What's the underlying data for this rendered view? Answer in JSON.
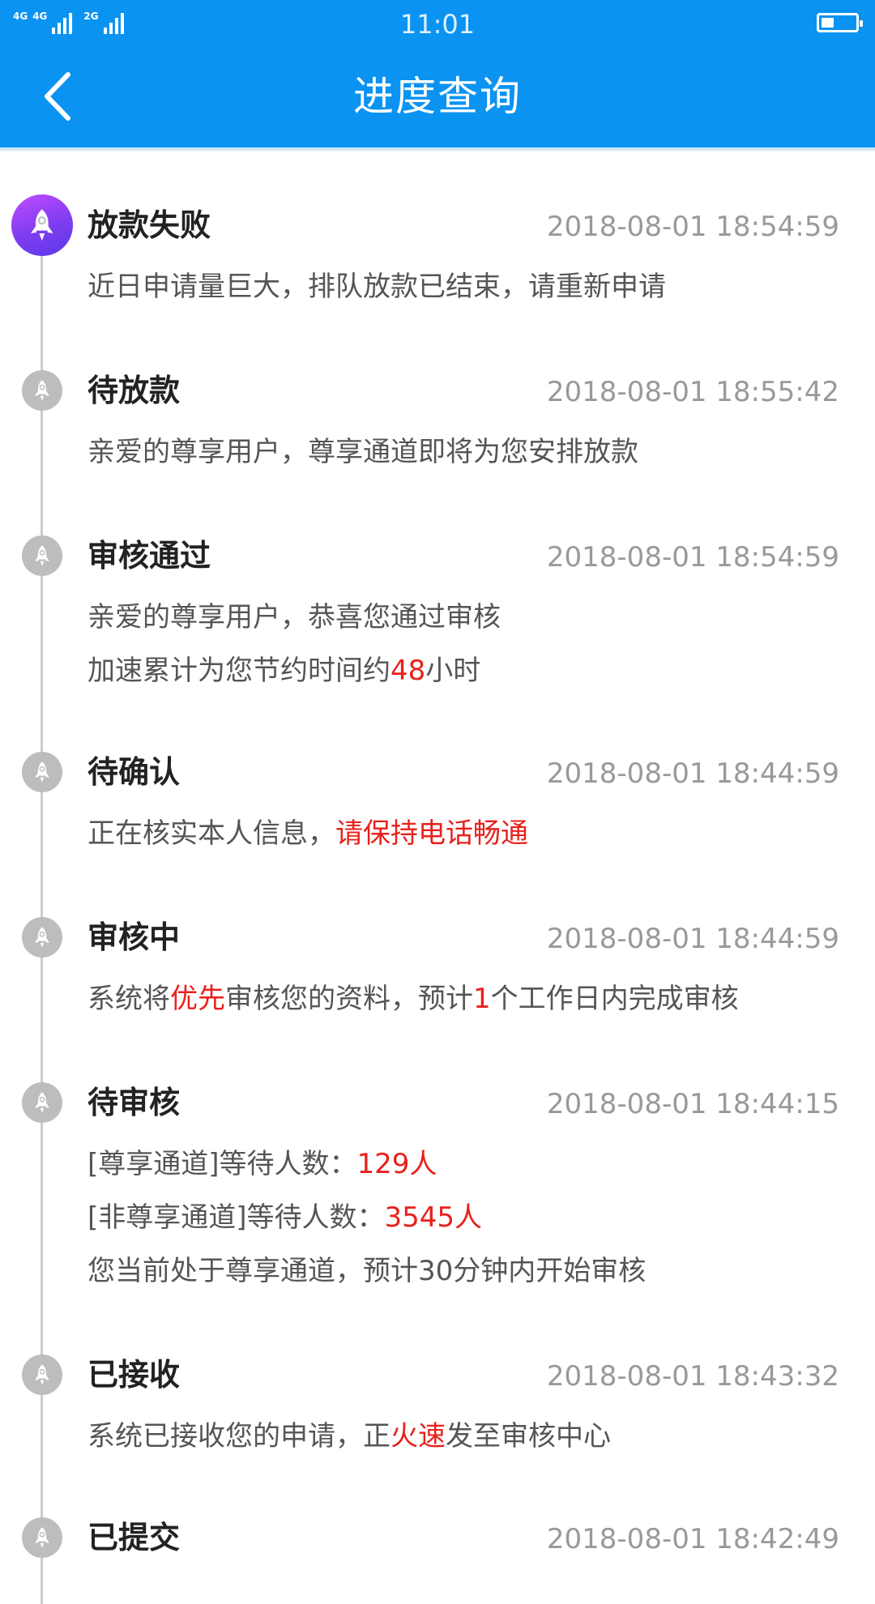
{
  "status_bar": {
    "signal1_label": "4G",
    "signal2_label": "4G",
    "signal3_label": "2G",
    "time": "11:01",
    "battery_level": 0.45
  },
  "header": {
    "title": "进度查询",
    "back_icon": "chevron-left-icon",
    "color": "#0b93f2"
  },
  "timeline": {
    "active_dot_color": "#8a3df2",
    "inactive_dot_color": "#bdbdbd",
    "highlight_color": "#e8211c",
    "entries": [
      {
        "title": "放款失败",
        "time": "2018-08-01 18:54:59",
        "lines": [
          [
            "近日申请量巨大，排队放款已结束，请重新申请"
          ]
        ]
      },
      {
        "title": "待放款",
        "time": "2018-08-01 18:55:42",
        "lines": [
          [
            "亲爱的尊享用户，尊享通道即将为您安排放款"
          ]
        ]
      },
      {
        "title": "审核通过",
        "time": "2018-08-01 18:54:59",
        "lines": [
          [
            "亲爱的尊享用户，恭喜您通过审核"
          ],
          [
            "加速累计为您节约时间约",
            "48",
            "小时"
          ]
        ]
      },
      {
        "title": "待确认",
        "time": "2018-08-01 18:44:59",
        "lines": [
          [
            "正在核实本人信息，",
            "请保持电话畅通"
          ]
        ]
      },
      {
        "title": "审核中",
        "time": "2018-08-01 18:44:59",
        "lines": [
          [
            "系统将",
            "优先",
            "审核您的资料，预计",
            "1",
            "个工作日内完成审核"
          ]
        ]
      },
      {
        "title": "待审核",
        "time": "2018-08-01 18:44:15",
        "lines": [
          [
            "[尊享通道]等待人数：",
            "129人"
          ],
          [
            "[非尊享通道]等待人数：",
            "3545人"
          ],
          [
            "您当前处于尊享通道，预计30分钟内开始审核"
          ]
        ]
      },
      {
        "title": "已接收",
        "time": "2018-08-01 18:43:32",
        "lines": [
          [
            "系统已接收您的申请，正",
            "火速",
            "发至审核中心"
          ]
        ]
      },
      {
        "title": "已提交",
        "time": "2018-08-01 18:42:49",
        "lines": []
      }
    ]
  }
}
